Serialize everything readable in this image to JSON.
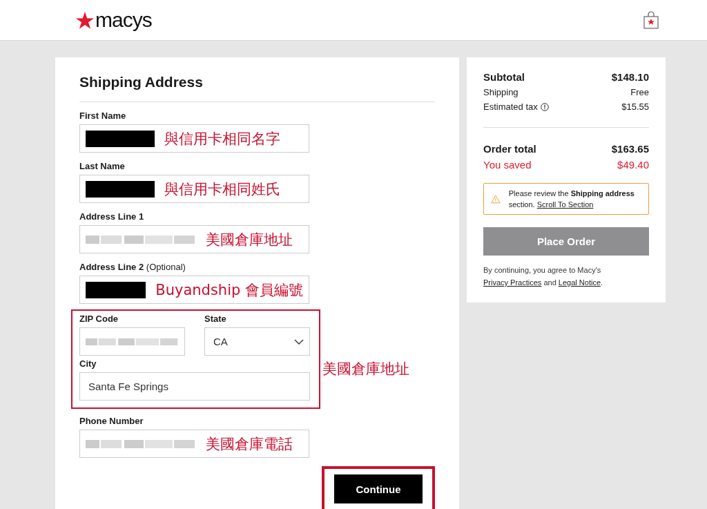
{
  "header": {
    "logo": "macys"
  },
  "form": {
    "title": "Shipping Address",
    "fields": [
      {
        "label": "First Name",
        "kind": "redacted",
        "annotation": "與信用卡相同名字"
      },
      {
        "label": "Last Name",
        "kind": "redacted",
        "annotation": "與信用卡相同姓氏"
      },
      {
        "label": "Address Line 1",
        "kind": "blurred",
        "annotation": "美國倉庫地址"
      },
      {
        "label": "Address Line 2",
        "hint": "(Optional)",
        "kind": "redacted",
        "annotation": "Buyandship 會員編號"
      }
    ],
    "highlight": {
      "annotation": "美國倉庫地址",
      "fields": [
        {
          "label": "ZIP Code",
          "kind": "blurred"
        },
        {
          "label": "State",
          "kind": "select",
          "value": "CA"
        },
        {
          "label": "City",
          "kind": "text",
          "value": "Santa Fe Springs"
        }
      ]
    },
    "after": [
      {
        "label": "Phone Number",
        "kind": "blurred",
        "annotation": "美國倉庫電話"
      }
    ],
    "continue": {
      "label": "Continue",
      "highlighted": true
    }
  },
  "summary": {
    "lines": [
      {
        "label": "Subtotal",
        "value": "$148.10",
        "kind": "bold"
      },
      {
        "label": "Shipping",
        "value": "Free",
        "kind": "plain"
      },
      {
        "label": "Estimated tax",
        "value": "$15.55",
        "kind": "info"
      }
    ],
    "total": {
      "label": "Order total",
      "value": "$163.65"
    },
    "saved": {
      "label": "You saved",
      "value": "$49.40"
    },
    "alert": {
      "text": "Please review the **Shipping address** section.",
      "link": "Scroll To Section"
    },
    "place_order": {
      "label": "Place Order",
      "disabled": true
    },
    "legal": [
      {
        "kind": "text",
        "text": "By continuing, you agree to Macy's"
      },
      {
        "kind": "link",
        "text": "Privacy Practices"
      },
      {
        "kind": "text",
        "text": "and"
      },
      {
        "kind": "link",
        "text": "Legal Notice"
      },
      {
        "kind": "text",
        "text": "."
      }
    ]
  }
}
